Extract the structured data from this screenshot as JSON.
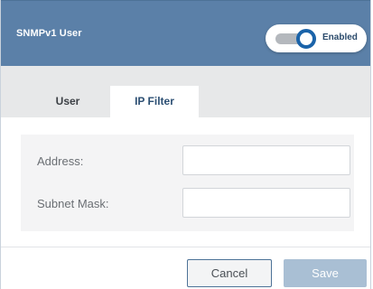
{
  "dialog": {
    "title": "SNMPv1 User",
    "enabled_toggle": {
      "label": "Enabled",
      "state": "on"
    }
  },
  "tabs": [
    {
      "label": "User",
      "active": false
    },
    {
      "label": "IP Filter",
      "active": true
    }
  ],
  "ip_filter": {
    "address": {
      "label": "Address:",
      "value": ""
    },
    "subnet_mask": {
      "label": "Subnet Mask:",
      "value": ""
    }
  },
  "footer": {
    "cancel_label": "Cancel",
    "save_label": "Save"
  },
  "colors": {
    "header": "#5b80a8",
    "toggle_knob": "#1a63a9",
    "save_disabled": "#a9bfd4"
  }
}
